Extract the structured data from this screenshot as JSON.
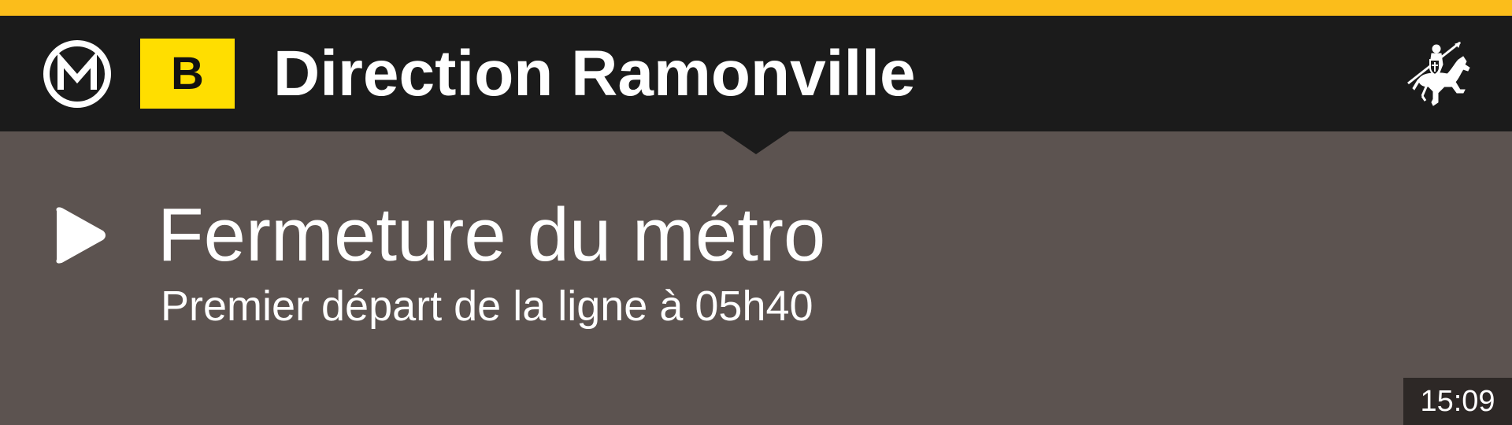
{
  "colors": {
    "accent": "#fbbd1b",
    "header_background": "#1b1b1b",
    "body_background": "#5c5350",
    "line_badge": "#ffde00",
    "clock_background": "#2d2826",
    "text": "#ffffff"
  },
  "header": {
    "metro_logo_icon": "metro-m-icon",
    "metro_logo_letter": "M",
    "line_badge": "B",
    "direction": "Direction Ramonville",
    "emblem_icon": "knight-on-horse-icon"
  },
  "message": {
    "icon": "play-icon",
    "title": "Fermeture du métro",
    "subtitle": "Premier départ de la ligne à 05h40"
  },
  "status": {
    "clock": "15:09"
  }
}
